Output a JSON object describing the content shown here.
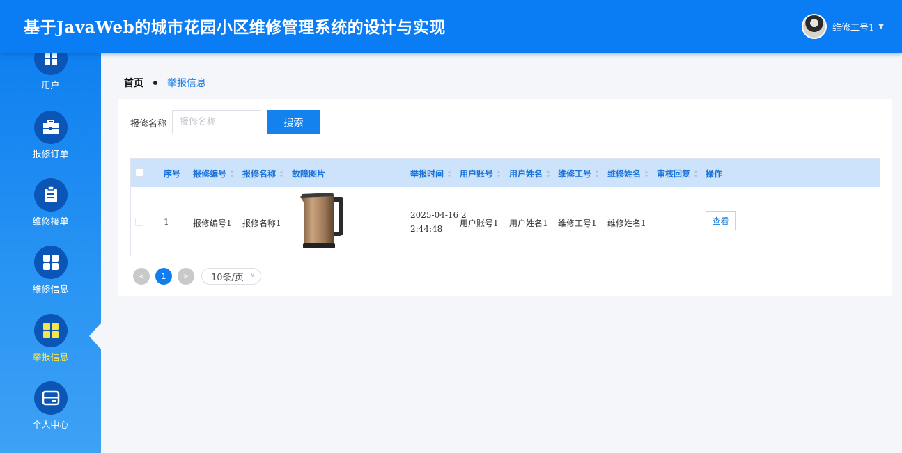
{
  "header": {
    "title": "基于JavaWeb的城市花园小区维修管理系统的设计与实现",
    "user_name": "维修工号1",
    "caret": "▼"
  },
  "sidebar": {
    "items": [
      {
        "label": "用户",
        "icon": "user-grid-icon"
      },
      {
        "label": "报修订单",
        "icon": "briefcase-icon"
      },
      {
        "label": "维修接单",
        "icon": "clipboard-icon"
      },
      {
        "label": "维修信息",
        "icon": "grid-icon"
      },
      {
        "label": "举报信息",
        "icon": "grid-icon",
        "active": true
      },
      {
        "label": "个人中心",
        "icon": "card-icon"
      }
    ],
    "active_color": "#f5e54a"
  },
  "breadcrumb": {
    "home": "首页",
    "current": "举报信息"
  },
  "search": {
    "label": "报修名称",
    "placeholder": "报修名称",
    "button": "搜索"
  },
  "table": {
    "headers": {
      "index": "序号",
      "repair_no": "报修编号",
      "repair_name": "报修名称",
      "image": "故障图片",
      "report_time": "举报时间",
      "user_account": "用户账号",
      "user_name": "用户姓名",
      "worker_no": "维修工号",
      "worker_name": "维修姓名",
      "review_reply": "审核回复",
      "actions": "操作"
    },
    "rows": [
      {
        "index": "1",
        "repair_no": "报修编号1",
        "repair_name": "报修名称1",
        "image": "electric-kettle-image",
        "report_time_line1": "2025-04-16 2",
        "report_time_line2": "2:44:48",
        "user_account": "用户账号1",
        "user_name": "用户姓名1",
        "worker_no": "维修工号1",
        "worker_name": "维修姓名1",
        "review_reply": "",
        "view_button": "查看"
      }
    ]
  },
  "pagination": {
    "prev": "<",
    "current_page": "1",
    "next": ">",
    "page_size": "10条/页"
  },
  "colors": {
    "primary": "#0a7cf4",
    "header_row": "#cde3fb",
    "link": "#1f7ee0"
  }
}
